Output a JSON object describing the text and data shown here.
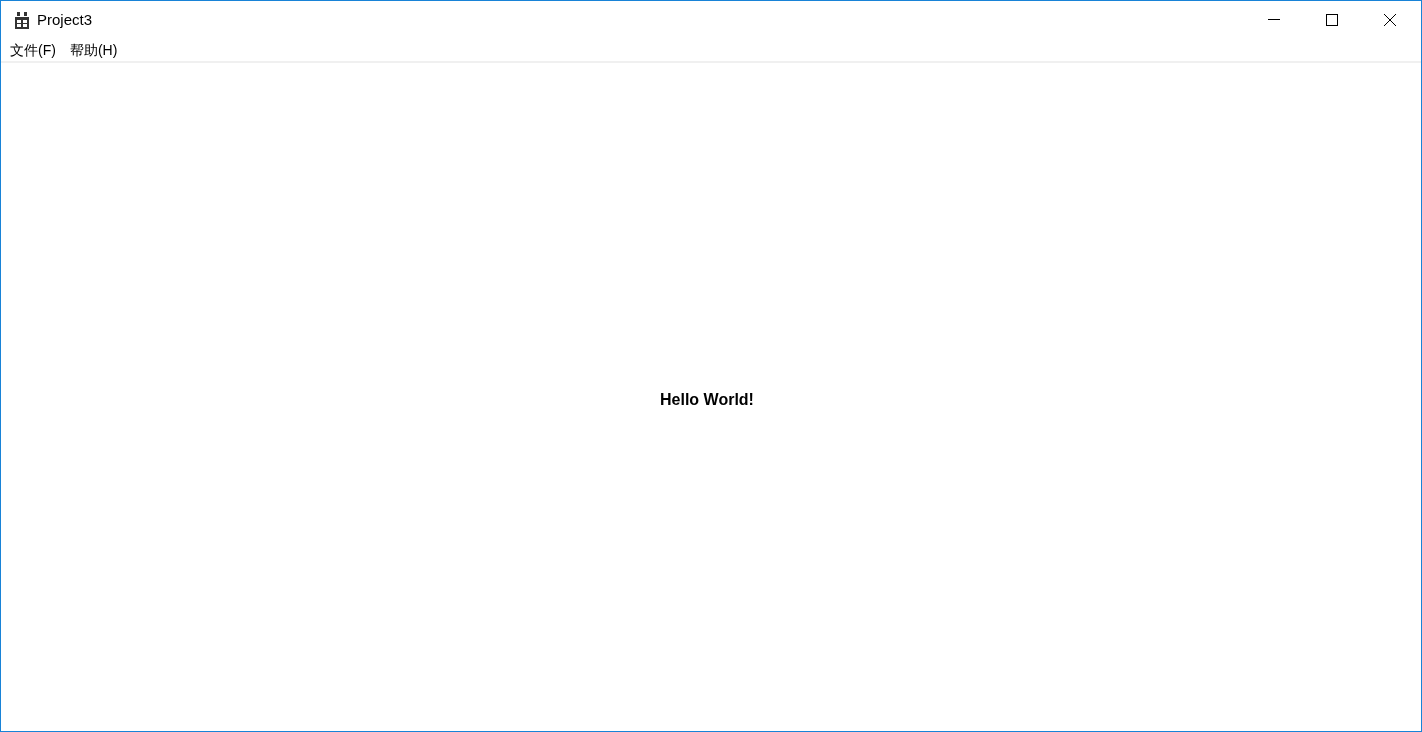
{
  "window": {
    "title": "Project3"
  },
  "menu": [
    "文件(F)",
    "帮助(H)"
  ],
  "content": {
    "text": "Hello World!"
  }
}
